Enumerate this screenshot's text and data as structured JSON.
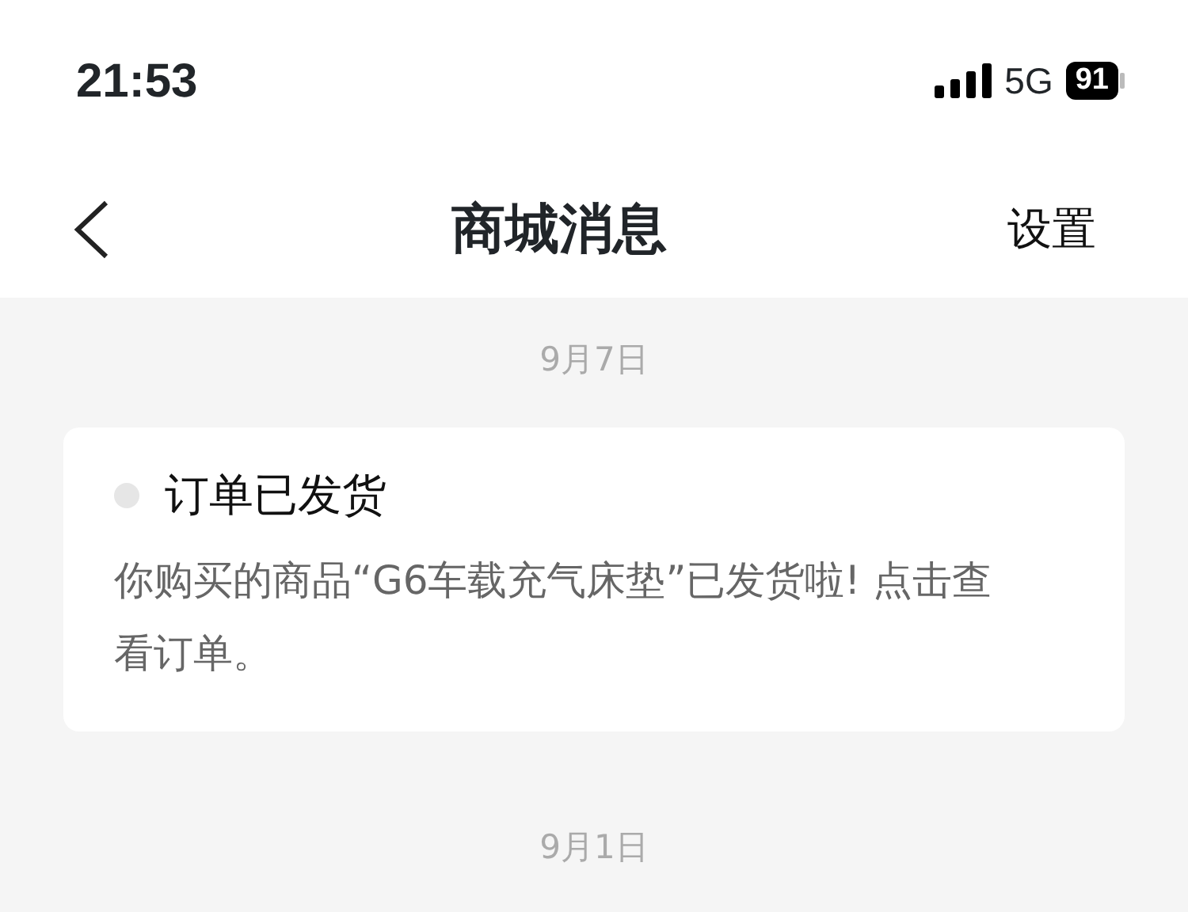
{
  "status_bar": {
    "time": "21:53",
    "network": "5G",
    "battery": "91"
  },
  "nav_bar": {
    "title": "商城消息",
    "action": "设置"
  },
  "messages": [
    {
      "date": "9月7日",
      "title": "订单已发货",
      "body": "你购买的商品“G6车载充气床垫”已发货啦! 点击查看订单。",
      "unread": false
    },
    {
      "date": "9月1日"
    }
  ]
}
